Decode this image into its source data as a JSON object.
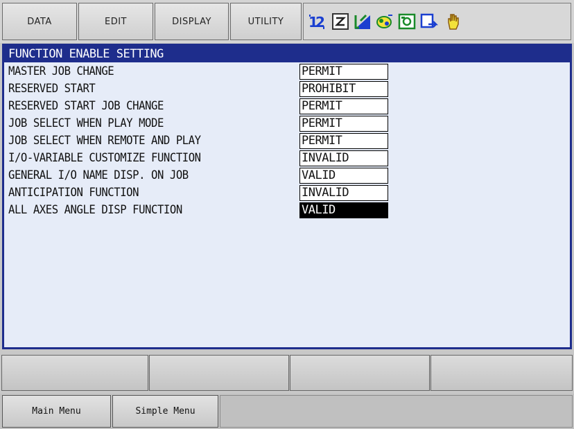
{
  "menu": {
    "items": [
      {
        "label": "DATA"
      },
      {
        "label": "EDIT"
      },
      {
        "label": "DISPLAY"
      },
      {
        "label": "UTILITY"
      }
    ]
  },
  "status_icons": [
    "axis-order-icon",
    "cycle-mode-icon",
    "security-level-icon",
    "coordinate-icon",
    "teach-mode-icon",
    "speed-icon",
    "hand-icon"
  ],
  "panel": {
    "title": "FUNCTION ENABLE SETTING",
    "rows": [
      {
        "label": "MASTER JOB CHANGE",
        "value": "PERMIT"
      },
      {
        "label": "RESERVED START",
        "value": "PROHIBIT"
      },
      {
        "label": "RESERVED START JOB CHANGE",
        "value": "PERMIT"
      },
      {
        "label": "JOB SELECT WHEN PLAY MODE",
        "value": "PERMIT"
      },
      {
        "label": "JOB SELECT WHEN REMOTE AND PLAY",
        "value": "PERMIT"
      },
      {
        "label": "I/O-VARIABLE CUSTOMIZE FUNCTION",
        "value": "INVALID"
      },
      {
        "label": "GENERAL I/O NAME DISP. ON JOB",
        "value": "VALID"
      },
      {
        "label": "ANTICIPATION FUNCTION",
        "value": "INVALID"
      },
      {
        "label": "ALL AXES ANGLE DISP FUNCTION",
        "value": "VALID",
        "selected": true
      }
    ]
  },
  "bottom": {
    "main_menu": "Main Menu",
    "simple_menu": "Simple Menu"
  },
  "colors": {
    "title_bar": "#1e2d8c",
    "panel_bg": "#e6ecf8",
    "selected_bg": "#000000"
  }
}
